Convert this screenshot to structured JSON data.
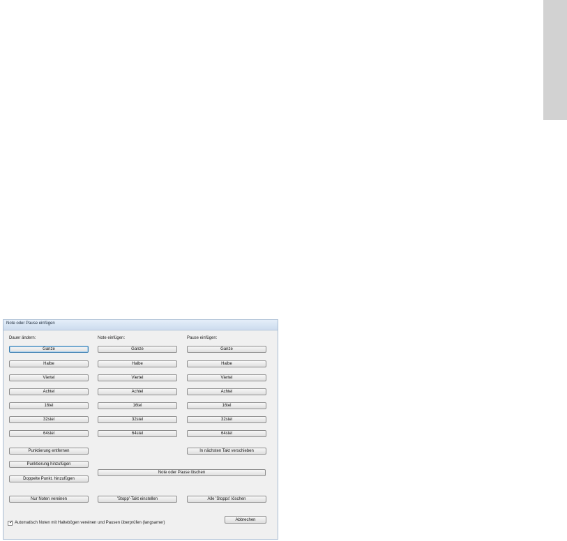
{
  "dialog": {
    "title": "Note oder Pause einfügen",
    "col_duration_label": "Dauer ändern:",
    "col_note_label": "Note einfügen:",
    "col_rest_label": "Pause einfügen:",
    "durations": [
      "Ganze",
      "Halbe",
      "Viertel",
      "Achtel",
      "16tel",
      "32stel",
      "64stel"
    ],
    "duration_buttons": [
      "Ganze",
      "Halbe",
      "Viertel",
      "Achtel",
      "16tel",
      "32stel",
      "64stel"
    ],
    "note_buttons": [
      "Ganze",
      "Halbe",
      "Viertel",
      "Achtel",
      "16tel",
      "32stel",
      "64stel"
    ],
    "rest_buttons": [
      "Ganze",
      "Halbe",
      "Viertel",
      "Achtel",
      "16tel",
      "32stel",
      "64stel"
    ],
    "remove_dot": "Punktierung entfernen",
    "add_dot": "Punktierung hinzufügen",
    "add_double_dot": "Doppelte Punkt. hinzufügen",
    "move_next_bar": "In nächsten Takt verschieben",
    "delete_note_rest": "Note oder Pause löschen",
    "merge_notes": "Nur Noten vereinen",
    "set_stop_bar": "'Stopp'-Takt einstellen",
    "delete_all_stops": "Alle 'Stopps' löschen",
    "checkbox_label": "Automatisch Noten mit Haltebögen vereinen und Pausen überprüfen (langsamer)",
    "checkbox_checked": true,
    "cancel": "Abbrechen"
  }
}
